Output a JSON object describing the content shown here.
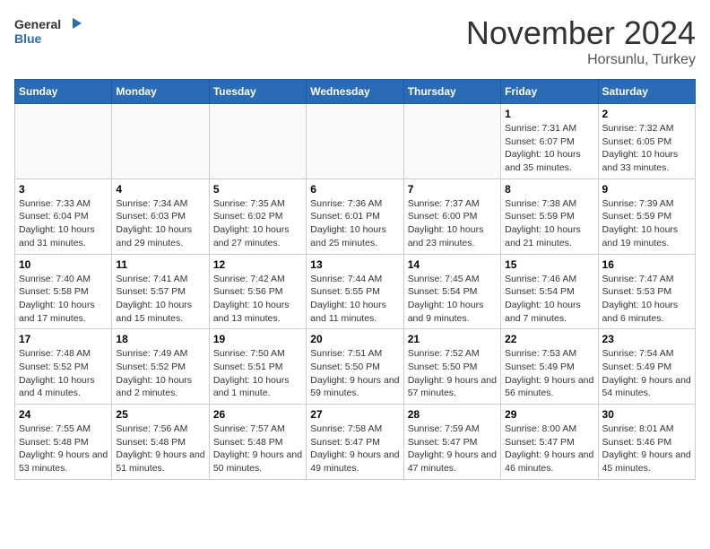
{
  "header": {
    "logo_general": "General",
    "logo_blue": "Blue",
    "month": "November 2024",
    "location": "Horsunlu, Turkey"
  },
  "weekdays": [
    "Sunday",
    "Monday",
    "Tuesday",
    "Wednesday",
    "Thursday",
    "Friday",
    "Saturday"
  ],
  "weeks": [
    [
      {
        "day": "",
        "info": ""
      },
      {
        "day": "",
        "info": ""
      },
      {
        "day": "",
        "info": ""
      },
      {
        "day": "",
        "info": ""
      },
      {
        "day": "",
        "info": ""
      },
      {
        "day": "1",
        "info": "Sunrise: 7:31 AM\nSunset: 6:07 PM\nDaylight: 10 hours and 35 minutes."
      },
      {
        "day": "2",
        "info": "Sunrise: 7:32 AM\nSunset: 6:05 PM\nDaylight: 10 hours and 33 minutes."
      }
    ],
    [
      {
        "day": "3",
        "info": "Sunrise: 7:33 AM\nSunset: 6:04 PM\nDaylight: 10 hours and 31 minutes."
      },
      {
        "day": "4",
        "info": "Sunrise: 7:34 AM\nSunset: 6:03 PM\nDaylight: 10 hours and 29 minutes."
      },
      {
        "day": "5",
        "info": "Sunrise: 7:35 AM\nSunset: 6:02 PM\nDaylight: 10 hours and 27 minutes."
      },
      {
        "day": "6",
        "info": "Sunrise: 7:36 AM\nSunset: 6:01 PM\nDaylight: 10 hours and 25 minutes."
      },
      {
        "day": "7",
        "info": "Sunrise: 7:37 AM\nSunset: 6:00 PM\nDaylight: 10 hours and 23 minutes."
      },
      {
        "day": "8",
        "info": "Sunrise: 7:38 AM\nSunset: 5:59 PM\nDaylight: 10 hours and 21 minutes."
      },
      {
        "day": "9",
        "info": "Sunrise: 7:39 AM\nSunset: 5:59 PM\nDaylight: 10 hours and 19 minutes."
      }
    ],
    [
      {
        "day": "10",
        "info": "Sunrise: 7:40 AM\nSunset: 5:58 PM\nDaylight: 10 hours and 17 minutes."
      },
      {
        "day": "11",
        "info": "Sunrise: 7:41 AM\nSunset: 5:57 PM\nDaylight: 10 hours and 15 minutes."
      },
      {
        "day": "12",
        "info": "Sunrise: 7:42 AM\nSunset: 5:56 PM\nDaylight: 10 hours and 13 minutes."
      },
      {
        "day": "13",
        "info": "Sunrise: 7:44 AM\nSunset: 5:55 PM\nDaylight: 10 hours and 11 minutes."
      },
      {
        "day": "14",
        "info": "Sunrise: 7:45 AM\nSunset: 5:54 PM\nDaylight: 10 hours and 9 minutes."
      },
      {
        "day": "15",
        "info": "Sunrise: 7:46 AM\nSunset: 5:54 PM\nDaylight: 10 hours and 7 minutes."
      },
      {
        "day": "16",
        "info": "Sunrise: 7:47 AM\nSunset: 5:53 PM\nDaylight: 10 hours and 6 minutes."
      }
    ],
    [
      {
        "day": "17",
        "info": "Sunrise: 7:48 AM\nSunset: 5:52 PM\nDaylight: 10 hours and 4 minutes."
      },
      {
        "day": "18",
        "info": "Sunrise: 7:49 AM\nSunset: 5:52 PM\nDaylight: 10 hours and 2 minutes."
      },
      {
        "day": "19",
        "info": "Sunrise: 7:50 AM\nSunset: 5:51 PM\nDaylight: 10 hours and 1 minute."
      },
      {
        "day": "20",
        "info": "Sunrise: 7:51 AM\nSunset: 5:50 PM\nDaylight: 9 hours and 59 minutes."
      },
      {
        "day": "21",
        "info": "Sunrise: 7:52 AM\nSunset: 5:50 PM\nDaylight: 9 hours and 57 minutes."
      },
      {
        "day": "22",
        "info": "Sunrise: 7:53 AM\nSunset: 5:49 PM\nDaylight: 9 hours and 56 minutes."
      },
      {
        "day": "23",
        "info": "Sunrise: 7:54 AM\nSunset: 5:49 PM\nDaylight: 9 hours and 54 minutes."
      }
    ],
    [
      {
        "day": "24",
        "info": "Sunrise: 7:55 AM\nSunset: 5:48 PM\nDaylight: 9 hours and 53 minutes."
      },
      {
        "day": "25",
        "info": "Sunrise: 7:56 AM\nSunset: 5:48 PM\nDaylight: 9 hours and 51 minutes."
      },
      {
        "day": "26",
        "info": "Sunrise: 7:57 AM\nSunset: 5:48 PM\nDaylight: 9 hours and 50 minutes."
      },
      {
        "day": "27",
        "info": "Sunrise: 7:58 AM\nSunset: 5:47 PM\nDaylight: 9 hours and 49 minutes."
      },
      {
        "day": "28",
        "info": "Sunrise: 7:59 AM\nSunset: 5:47 PM\nDaylight: 9 hours and 47 minutes."
      },
      {
        "day": "29",
        "info": "Sunrise: 8:00 AM\nSunset: 5:47 PM\nDaylight: 9 hours and 46 minutes."
      },
      {
        "day": "30",
        "info": "Sunrise: 8:01 AM\nSunset: 5:46 PM\nDaylight: 9 hours and 45 minutes."
      }
    ]
  ]
}
